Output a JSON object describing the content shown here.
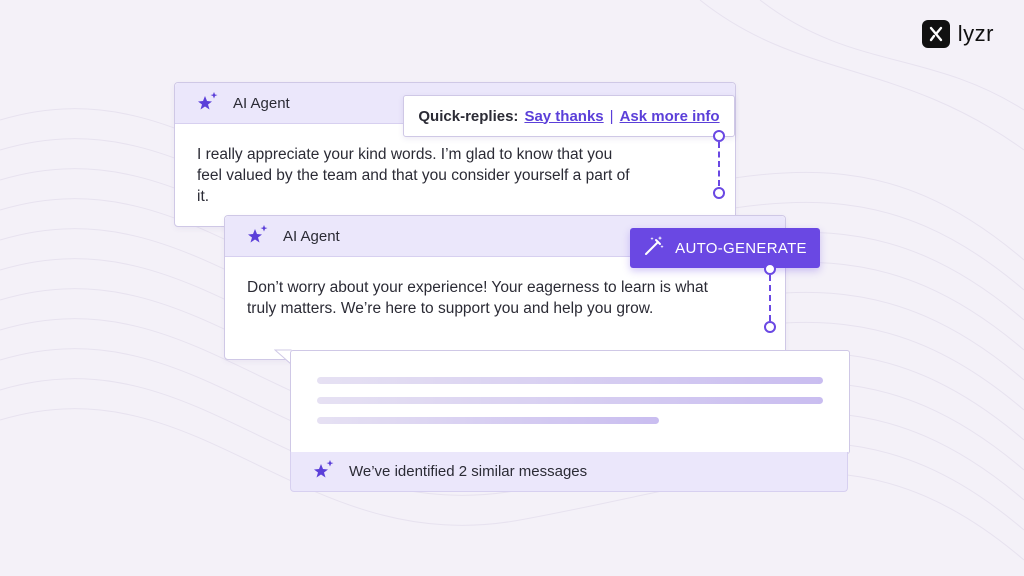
{
  "brand": {
    "name": "lyzr"
  },
  "cards": [
    {
      "title": "AI Agent",
      "message": "I really appreciate your kind words. I’m glad to know that you feel valued by the team and that you consider yourself a part of it."
    },
    {
      "title": "AI Agent",
      "message": "Don’t worry about your experience! Your eagerness to learn is what truly matters. We’re here to support you and help you grow."
    }
  ],
  "quick_replies": {
    "label": "Quick-replies:",
    "options": [
      "Say thanks",
      "Ask more info"
    ],
    "separator": "|"
  },
  "auto_generate": {
    "label": "AUTO-GENERATE"
  },
  "similar": {
    "text": "We’ve identified 2 similar messages"
  },
  "colors": {
    "accent": "#6a48e3",
    "header_bg": "#ebe7fb",
    "background": "#f4f1f8",
    "text": "#2b2b35"
  },
  "icons": {
    "agent": "sparkle-stars-icon",
    "auto_generate": "magic-wand-icon",
    "brand": "lyzr-logo-icon"
  }
}
